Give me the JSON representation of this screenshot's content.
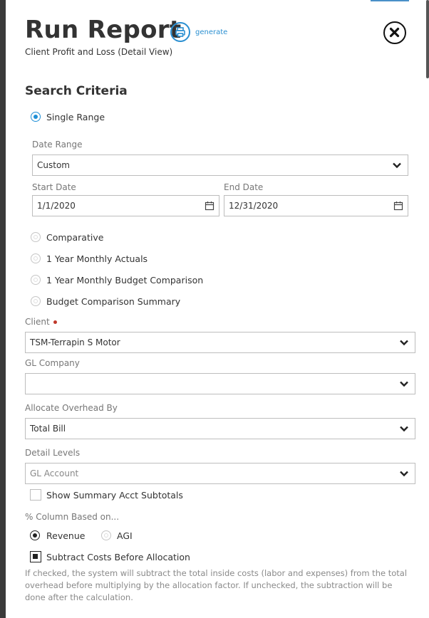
{
  "header": {
    "title": "Run Report",
    "subtitle": "Client Profit and Loss (Detail View)",
    "generate_label": "generate"
  },
  "search_criteria": {
    "heading": "Search Criteria",
    "single_range_label": "Single Range",
    "date_range_label": "Date Range",
    "date_range_value": "Custom",
    "start_date_label": "Start Date",
    "start_date_value": "1/1/2020",
    "end_date_label": "End Date",
    "end_date_value": "12/31/2020",
    "comparative_label": "Comparative",
    "monthly_actuals_label": "1 Year Monthly Actuals",
    "monthly_budget_label": "1 Year Monthly Budget Comparison",
    "budget_summary_label": "Budget Comparison Summary",
    "selected_mode": "Single Range"
  },
  "client": {
    "label": "Client",
    "value": "TSM-Terrapin S Motor",
    "required": true
  },
  "gl_company": {
    "label": "GL Company",
    "value": ""
  },
  "allocate_overhead": {
    "label": "Allocate Overhead By",
    "value": "Total Bill"
  },
  "detail_levels": {
    "label": "Detail Levels",
    "placeholder": "GL Account"
  },
  "summary_subtotals": {
    "label": "Show Summary Acct Subtotals",
    "checked": false
  },
  "percent_column": {
    "label": "% Column Based on...",
    "revenue_label": "Revenue",
    "agi_label": "AGI",
    "selected": "Revenue"
  },
  "subtract_costs": {
    "label": "Subtract Costs Before Allocation",
    "checked": true,
    "help_text": "If checked, the system will subtract the total inside costs (labor and expenses) from the total overhead before multiplying by the allocation factor. If unchecked, the subtraction will be done after the calculation."
  },
  "colors": {
    "accent": "#1f8fd6",
    "text": "#333333",
    "muted": "#777777",
    "required": "#c0392b",
    "rail": "#3a3a3a"
  },
  "icons": {
    "generate": "print-icon",
    "close": "close-icon",
    "dropdown": "chevron-down-icon",
    "date": "calendar-icon"
  }
}
